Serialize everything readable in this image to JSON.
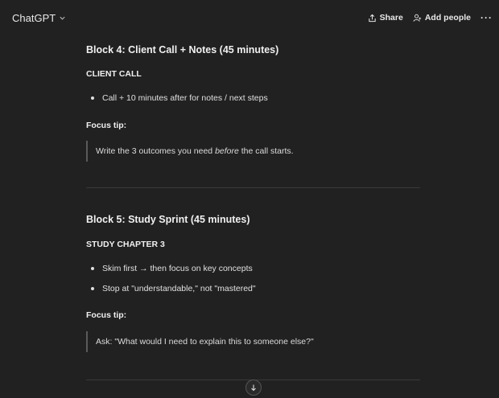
{
  "header": {
    "app_title": "ChatGPT",
    "share_label": "Share",
    "add_people_label": "Add people",
    "more_label": "···"
  },
  "blocks": [
    {
      "title": "Block 4: Client Call + Notes (45 minutes)",
      "heading": "CLIENT CALL",
      "bullets": [
        "Call + 10 minutes after for notes / next steps"
      ],
      "tip_label": "Focus tip:",
      "tip_before": "Write the 3 outcomes you need ",
      "tip_emphasis": "before",
      "tip_after": " the call starts."
    },
    {
      "title": "Block 5: Study Sprint (45 minutes)",
      "heading": "STUDY CHAPTER 3",
      "bullets": [
        "Skim first → then focus on key concepts",
        "Stop at \"understandable,\" not \"mastered\""
      ],
      "tip_label": "Focus tip:",
      "tip_text": "Ask: \"What would I need to explain this to someone else?\""
    }
  ]
}
